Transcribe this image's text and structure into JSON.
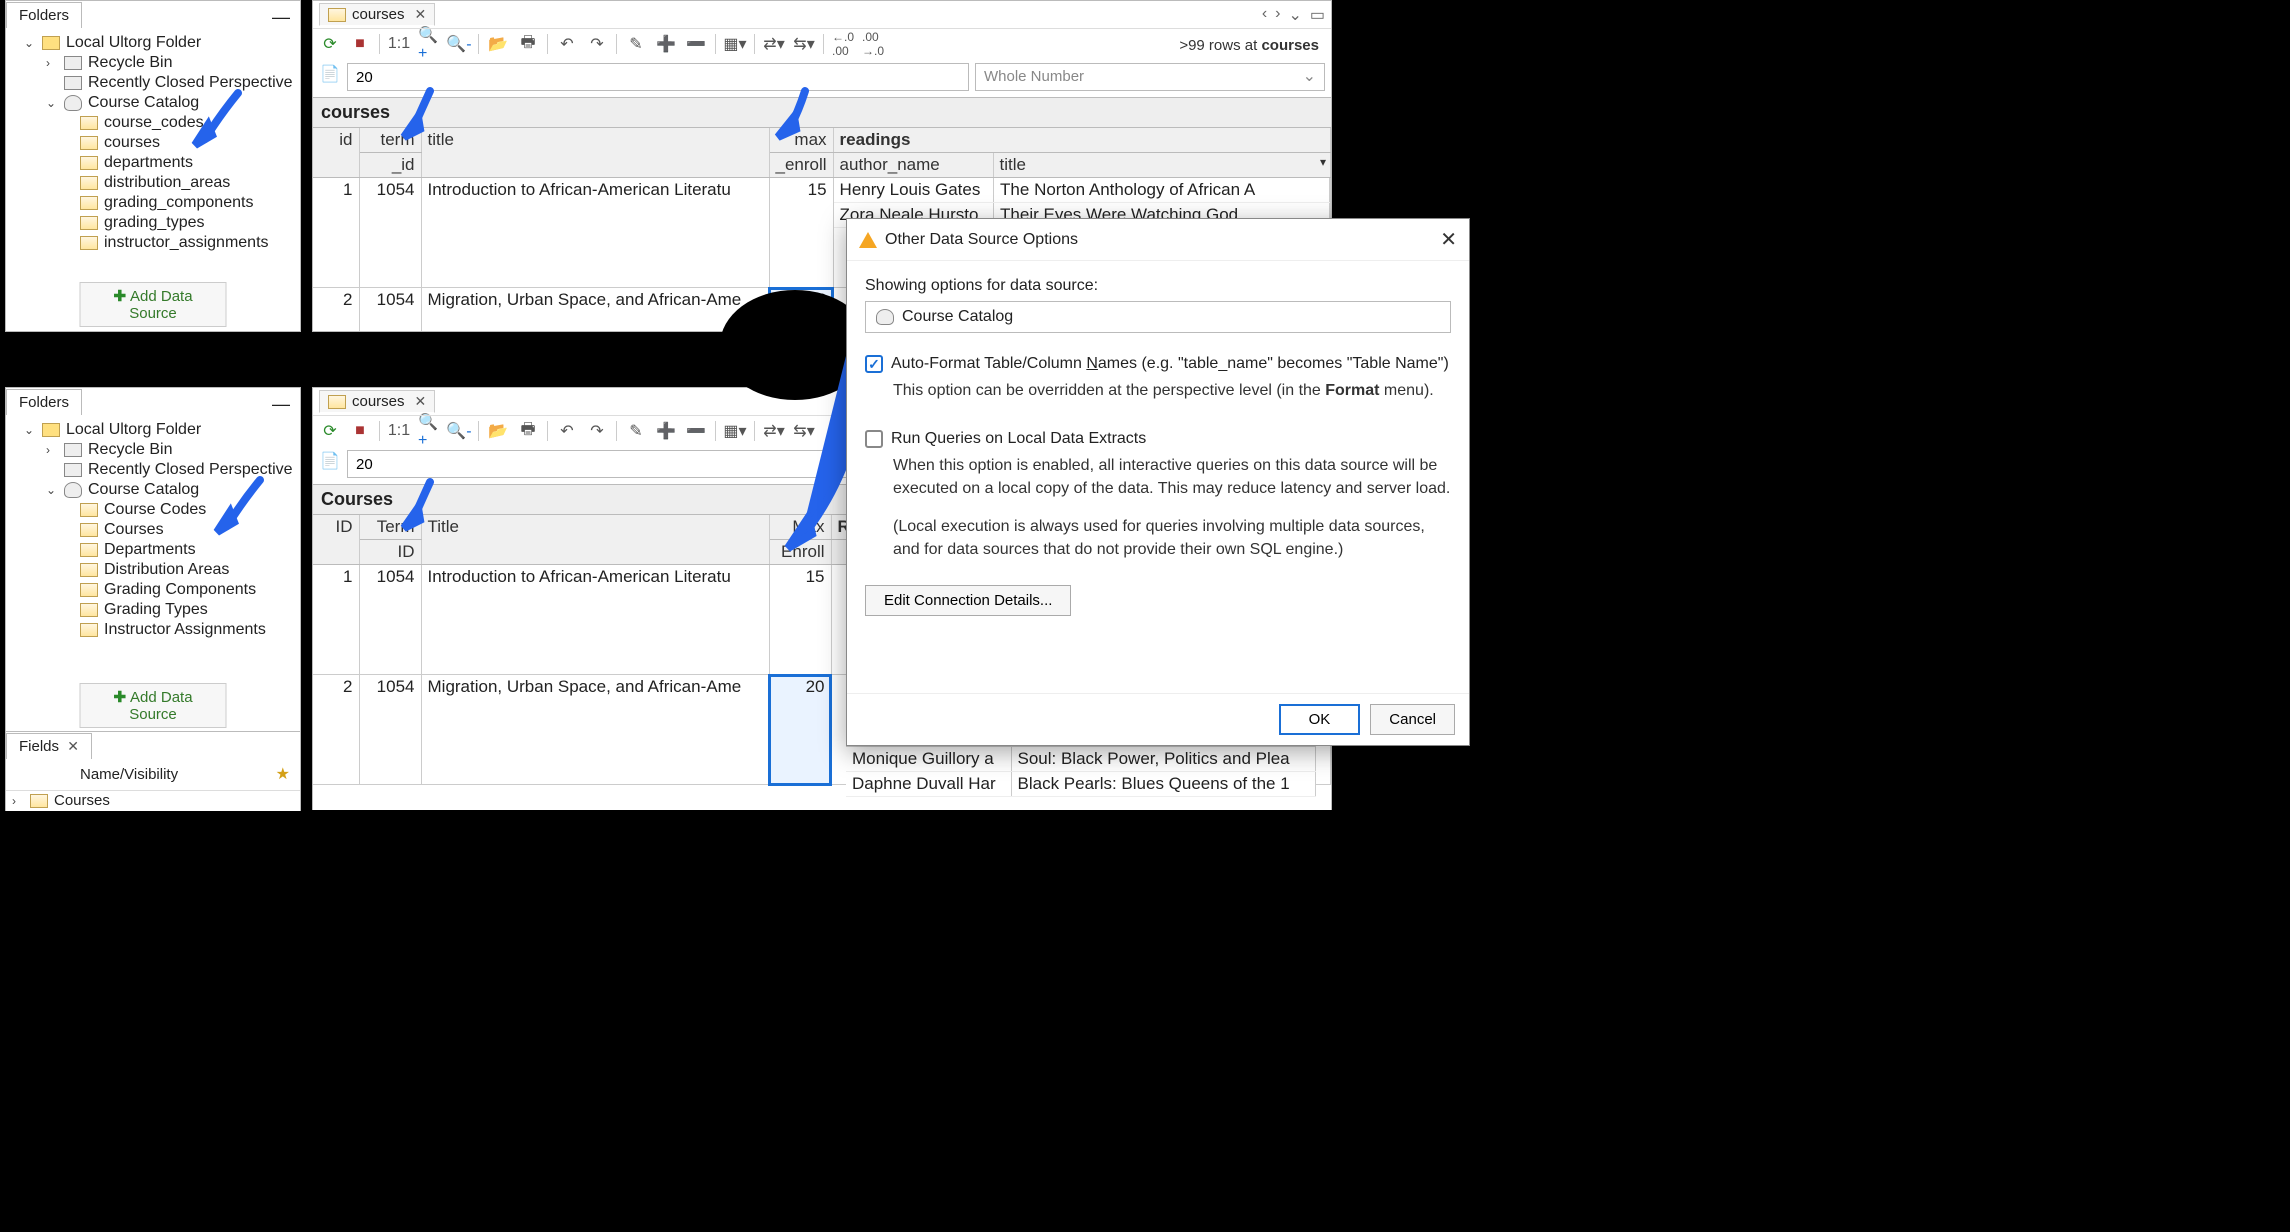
{
  "folders": {
    "tab_label": "Folders",
    "root": "Local Ultorg Folder",
    "recycle": "Recycle Bin",
    "recent_persp": "Recently Closed Perspective",
    "catalog": "Course Catalog",
    "tables_a": [
      "course_codes",
      "courses",
      "departments",
      "distribution_areas",
      "grading_components",
      "grading_types",
      "instructor_assignments"
    ],
    "tables_b": [
      "Course Codes",
      "Courses",
      "Departments",
      "Distribution Areas",
      "Grading Components",
      "Grading Types",
      "Instructor Assignments"
    ],
    "add_datasource": "Add Data Source"
  },
  "perspective": {
    "tab_label": "courses",
    "row_status_prefix": ">99 rows at",
    "row_status_table": "courses",
    "cell_value": "20",
    "type_placeholder": "Whole Number",
    "ratio": "1:1"
  },
  "grid_a": {
    "root": "courses",
    "cols": {
      "id": "id",
      "term": "term",
      "term2": "_id",
      "title": "title",
      "enroll": "max",
      "enroll2": "_enroll",
      "readings": "readings",
      "author": "author_name",
      "btitle": "title"
    }
  },
  "grid_b": {
    "root": "Courses",
    "cols": {
      "id": "ID",
      "term": "Term",
      "term2": "ID",
      "title": "Title",
      "enroll": "Max",
      "enroll2": "Enroll",
      "readings": "R"
    }
  },
  "rows": [
    {
      "id": "1",
      "term": "1054",
      "title": "Introduction to African-American Literatu",
      "enroll": "15",
      "readings": [
        {
          "author": "Henry Louis Gates",
          "title": "The Norton Anthology of African A"
        },
        {
          "author": "Zora Neale Hursto",
          "title": "Their Eyes Were Watching God"
        }
      ]
    },
    {
      "id": "2",
      "term": "1054",
      "title": "Migration, Urban Space, and African-Ame",
      "enroll": "20",
      "readings": []
    }
  ],
  "readings_overflow": [
    {
      "author": "Monique Guillory a",
      "title": "Soul: Black Power, Politics and Plea"
    },
    {
      "author": "Daphne Duvall Har",
      "title": "Black Pearls: Blues Queens of the 1"
    }
  ],
  "dialog": {
    "title": "Other Data Source Options",
    "showing_label": "Showing options for data source:",
    "ds_name": "Course Catalog",
    "opt1_label": "Auto-Format Table/Column Names (e.g. \"table_name\" becomes \"Table Name\")",
    "opt1_desc_a": "This option can be overridden at the perspective level (in the ",
    "opt1_desc_b": "Format",
    "opt1_desc_c": " menu).",
    "opt2_label": "Run Queries on Local Data Extracts",
    "opt2_desc1": "When this option is enabled, all interactive queries on this data source will be executed on a local copy of the data. This may reduce latency and server load.",
    "opt2_desc2": "(Local execution is always used for queries involving multiple data sources, and for data sources that do not provide their own SQL engine.)",
    "edit_conn": "Edit Connection Details...",
    "ok": "OK",
    "cancel": "Cancel"
  },
  "fields": {
    "tab_label": "Fields",
    "col": "Name/Visibility",
    "row1": "Courses"
  }
}
